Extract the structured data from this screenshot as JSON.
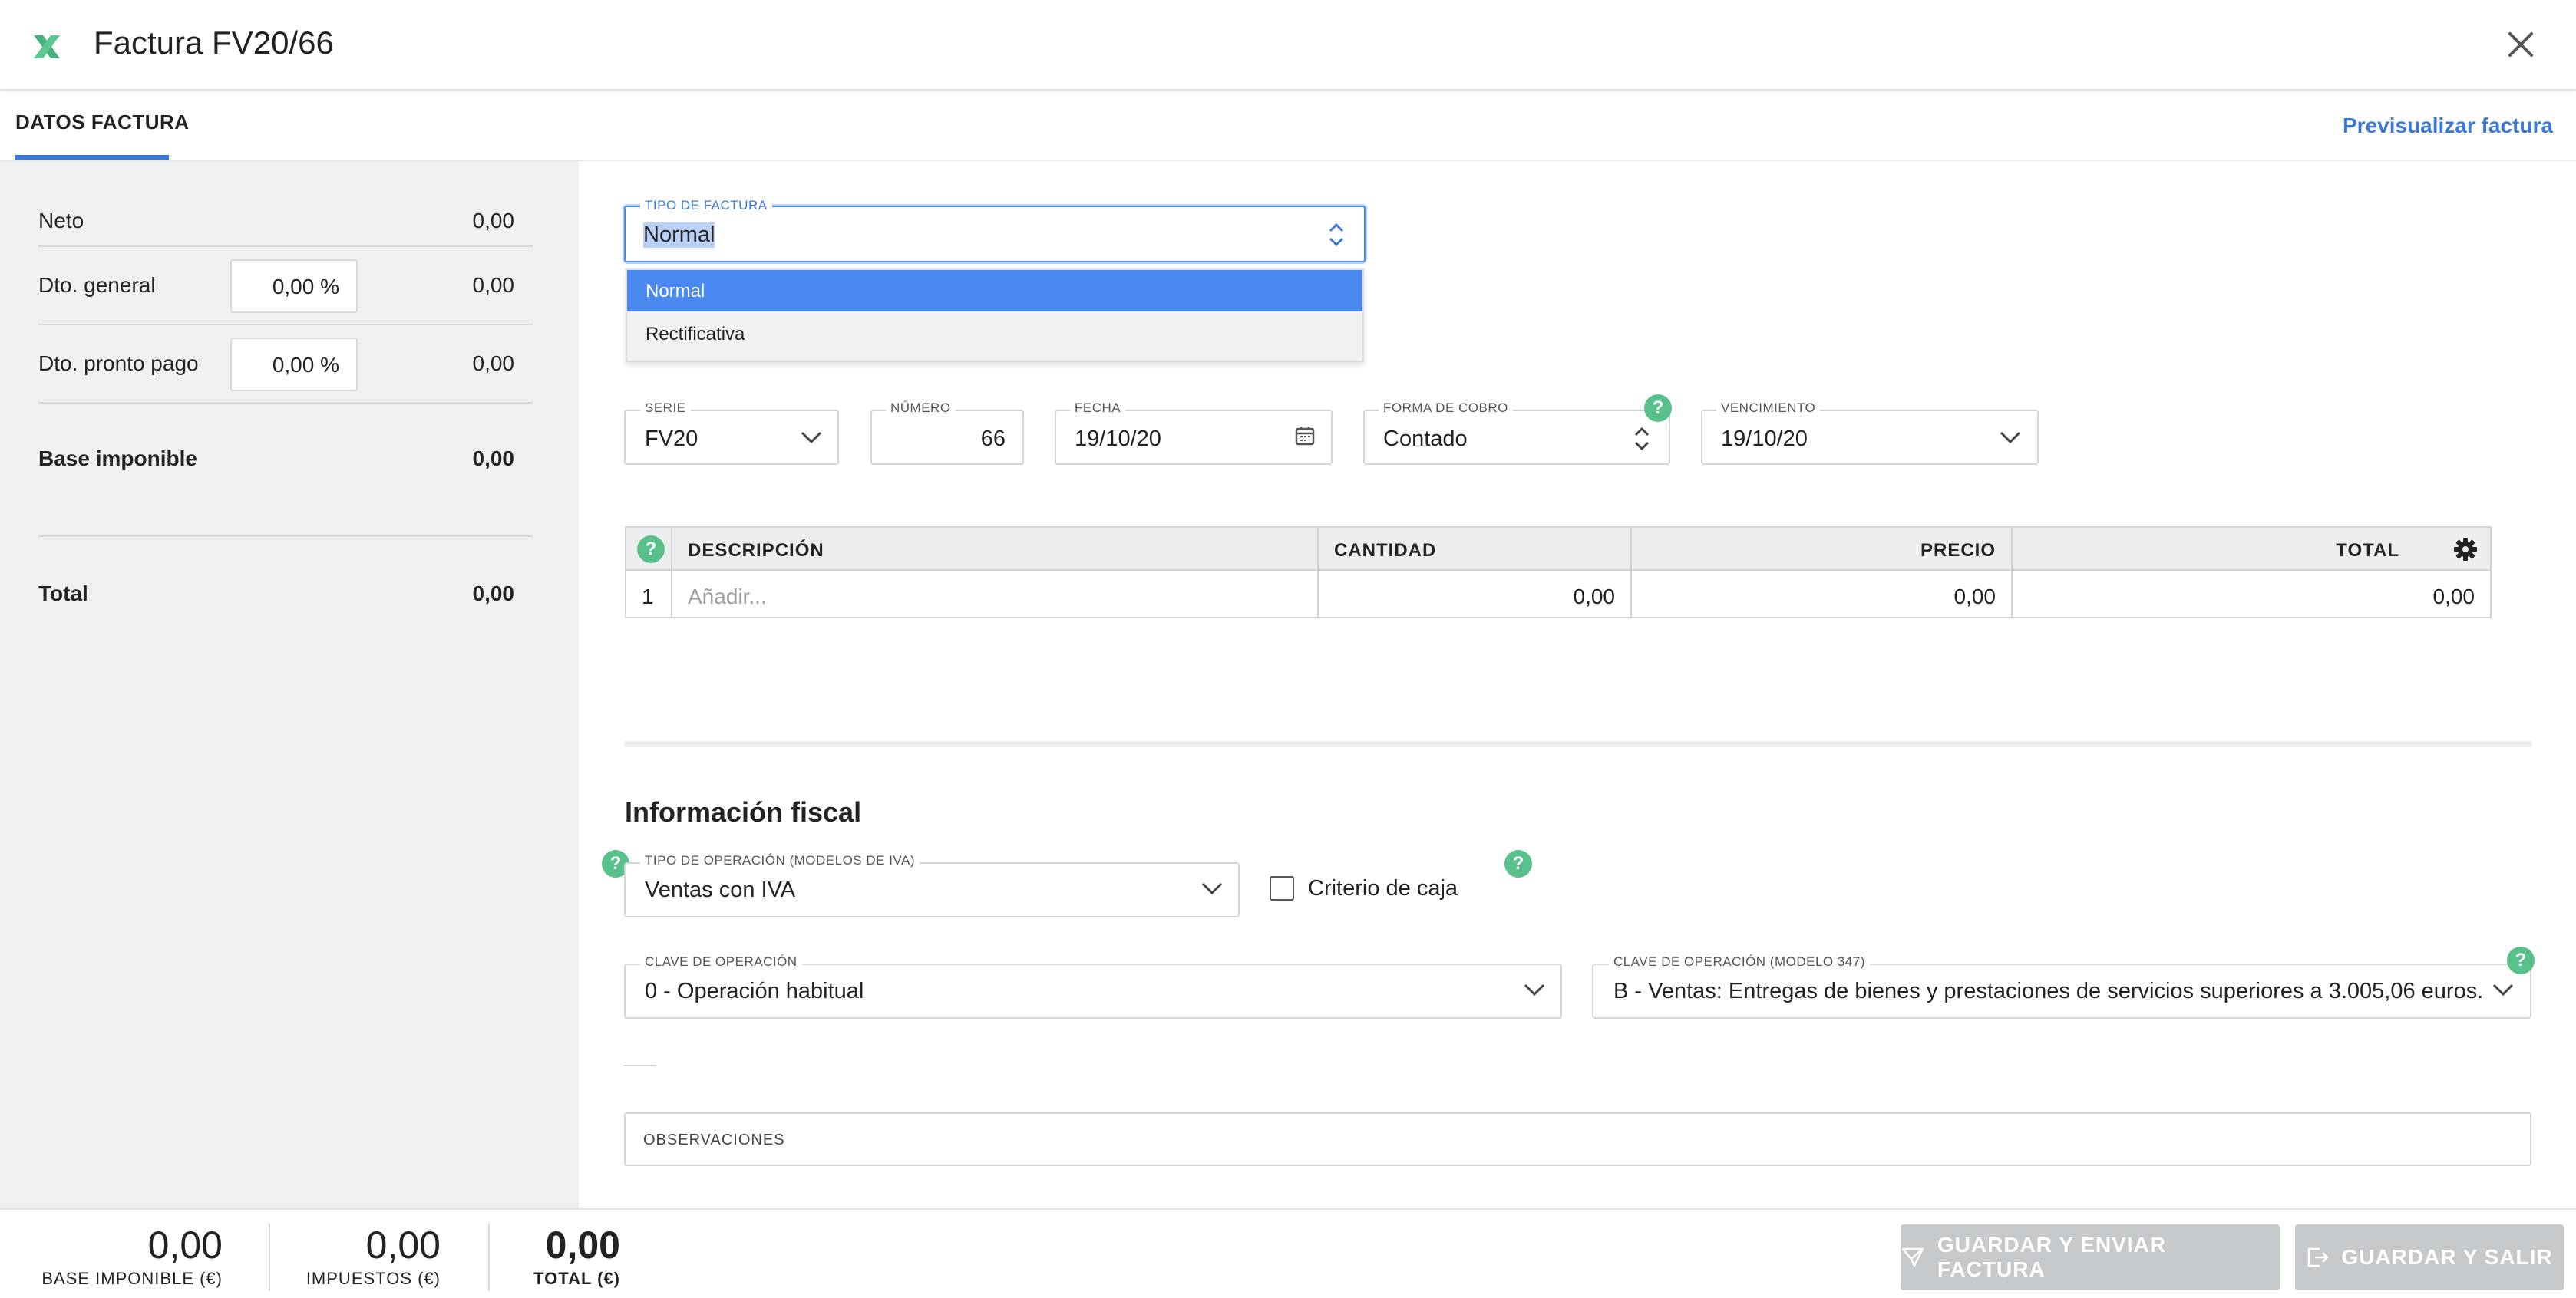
{
  "header": {
    "title": "Factura FV20/66",
    "close_label": "×"
  },
  "tabs": {
    "active": "DATOS FACTURA",
    "preview_link": "Previsualizar factura"
  },
  "summary": {
    "neto_label": "Neto",
    "neto_value": "0,00",
    "dto_general_label": "Dto. general",
    "dto_general_pct": "0,00 %",
    "dto_general_value": "0,00",
    "dto_pronto_label": "Dto. pronto pago",
    "dto_pronto_pct": "0,00 %",
    "dto_pronto_value": "0,00",
    "base_label": "Base imponible",
    "base_value": "0,00",
    "total_label": "Total",
    "total_value": "0,00"
  },
  "invoice_type": {
    "label": "TIPO DE FACTURA",
    "value": "Normal",
    "options": [
      "Normal",
      "Rectificativa"
    ]
  },
  "fields": {
    "serie_label": "SERIE",
    "serie_value": "FV20",
    "numero_label": "NÚMERO",
    "numero_value": "66",
    "fecha_label": "FECHA",
    "fecha_value": "19/10/20",
    "forma_label": "FORMA DE COBRO",
    "forma_value": "Contado",
    "venc_label": "VENCIMIENTO",
    "venc_value": "19/10/20"
  },
  "lines_table": {
    "headers": [
      "DESCRIPCIÓN",
      "CANTIDAD",
      "PRECIO",
      "TOTAL"
    ],
    "rows": [
      {
        "num": "1",
        "descripcion": "Añadir...",
        "cantidad": "0,00",
        "precio": "0,00",
        "total": "0,00"
      }
    ]
  },
  "fiscal": {
    "title": "Información fiscal",
    "tipo_op_label": "TIPO DE OPERACIÓN (MODELOS DE IVA)",
    "tipo_op_value": "Ventas con IVA",
    "criterio_caja": "Criterio de caja",
    "clave_label": "CLAVE DE OPERACIÓN",
    "clave_value": "0 - Operación habitual",
    "clave347_label": "CLAVE DE OPERACIÓN (MODELO 347)",
    "clave347_value": "B - Ventas: Entregas de bienes y prestaciones de servicios superiores a 3.005,06 euros.",
    "observaciones_label": "OBSERVACIONES"
  },
  "footer": {
    "base_value": "0,00",
    "base_label": "BASE IMPONIBLE (€)",
    "impuestos_value": "0,00",
    "impuestos_label": "IMPUESTOS (€)",
    "total_value": "0,00",
    "total_label": "TOTAL (€)",
    "send_button": "GUARDAR Y ENVIAR FACTURA",
    "save_exit_button": "GUARDAR Y SALIR"
  },
  "colors": {
    "accent": "#3d7ad6",
    "help_green": "#58c08b",
    "selected_option": "#4a8af0",
    "disabled_button": "#c6c9cc"
  },
  "icons": [
    "app-logo-icon",
    "close-icon",
    "chevron-down-icon",
    "sort-arrows-icon",
    "calendar-icon",
    "help-icon",
    "gear-icon",
    "send-icon",
    "exit-icon"
  ]
}
